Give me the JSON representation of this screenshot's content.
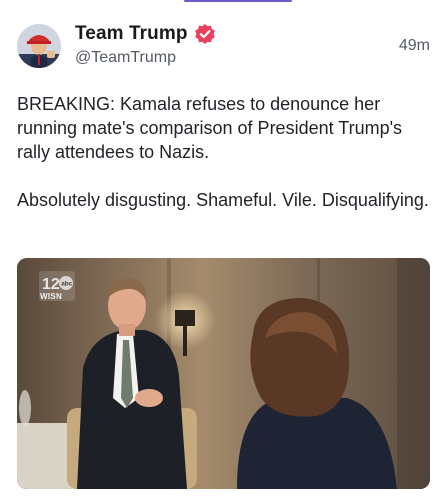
{
  "post": {
    "author": {
      "display_name": "Team Trump",
      "handle": "@TeamTrump",
      "verified": true,
      "avatar_icon": "avatar-photo"
    },
    "time": "49m",
    "text": {
      "paragraph1": "BREAKING: Kamala refuses to denounce her running mate's comparison of President Trump's rally attendees to Nazis.",
      "paragraph2": "Absolutely disgusting. Shameful. Vile. Disqualifying."
    },
    "media": {
      "watermark": "WISN",
      "watermark_badge": "12 abc"
    }
  },
  "colors": {
    "accent": "#6a5acd",
    "verified_badge": "#e8415d",
    "text": "#1f2328",
    "muted": "#555b62"
  }
}
